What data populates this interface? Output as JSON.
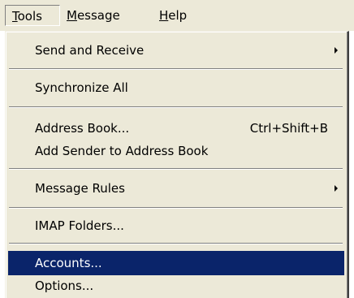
{
  "menubar": {
    "tools": {
      "mnemonic": "T",
      "rest": "ools"
    },
    "message": {
      "mnemonic": "M",
      "rest": "essage"
    },
    "help": {
      "mnemonic": "H",
      "rest": "elp"
    }
  },
  "tools_menu": {
    "send_receive": "Send and Receive",
    "synchronize_all": "Synchronize All",
    "address_book": "Address Book...",
    "address_book_shortcut": "Ctrl+Shift+B",
    "add_sender": "Add Sender to Address Book",
    "message_rules": "Message Rules",
    "imap_folders": "IMAP Folders...",
    "accounts": "Accounts...",
    "options": "Options..."
  },
  "icons": {
    "submenu_arrow": "triangle-right"
  },
  "colors": {
    "menu_background": "#ece9d8",
    "highlight_background": "#0a246a",
    "highlight_text": "#ffffff"
  }
}
